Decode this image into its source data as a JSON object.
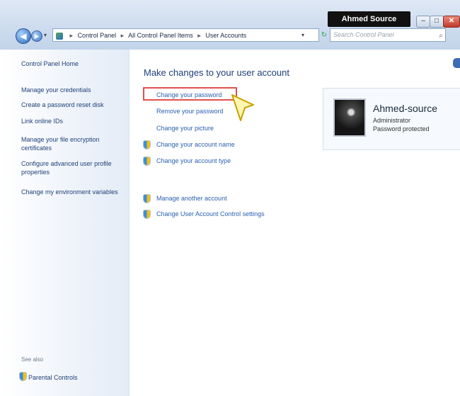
{
  "window": {
    "title": "Ahmed Source"
  },
  "colors": {
    "accent": "#2a5fb0",
    "highlight": "#e05050",
    "sidebar_bg": "#e4ecf7"
  },
  "address_bar": {
    "crumbs": [
      "Control Panel",
      "All Control Panel Items",
      "User Accounts"
    ]
  },
  "search": {
    "placeholder": "Search Control Panel"
  },
  "sidebar": {
    "items": [
      {
        "label": "Control Panel Home"
      },
      {
        "label": "Manage your credentials"
      },
      {
        "label": "Create a password reset disk"
      },
      {
        "label": "Link online IDs"
      },
      {
        "label": "Manage your file encryption certificates"
      },
      {
        "label": "Configure advanced user profile properties"
      },
      {
        "label": "Change my environment variables"
      }
    ],
    "see_also": "See also",
    "parental_controls": "Parental Controls"
  },
  "main": {
    "title": "Make changes to your user account",
    "tasks": [
      {
        "label": "Change your password",
        "shield": false
      },
      {
        "label": "Remove your password",
        "shield": false
      },
      {
        "label": "Change your picture",
        "shield": false
      },
      {
        "label": "Change your account name",
        "shield": true
      },
      {
        "label": "Change your account type",
        "shield": true
      }
    ],
    "other_tasks": [
      {
        "label": "Manage another account",
        "shield": true
      },
      {
        "label": "Change User Account Control settings",
        "shield": true
      }
    ]
  },
  "user": {
    "name": "Ahmed-source",
    "role": "Administrator",
    "status": "Password protected"
  }
}
